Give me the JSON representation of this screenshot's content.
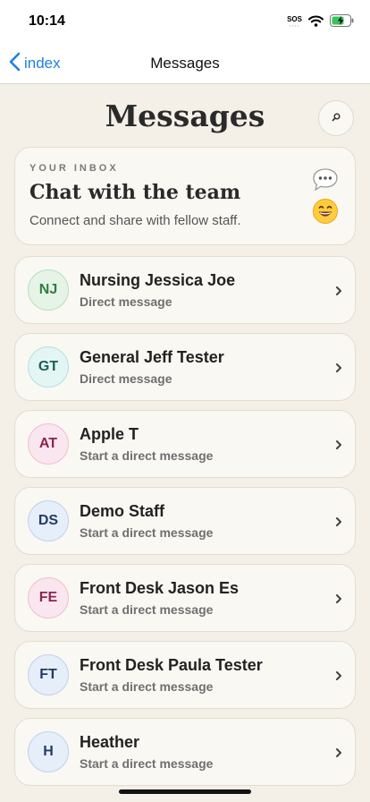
{
  "status_bar": {
    "time": "10:14",
    "sos": "SOS"
  },
  "nav": {
    "back_label": "index",
    "title": "Messages"
  },
  "page": {
    "title": "Messages"
  },
  "inbox_card": {
    "eyebrow": "YOUR INBOX",
    "heading": "Chat with the team",
    "subtitle": "Connect and share with fellow staff.",
    "icons": [
      "speech-bubble-icon",
      "grinning-face-icon"
    ]
  },
  "contacts": [
    {
      "initials": "NJ",
      "name": "Nursing Jessica Joe",
      "subtitle": "Direct message",
      "avatar_bg": "#e6f4e8",
      "avatar_border": "#b8dfc0",
      "avatar_fg": "#2e7d3e"
    },
    {
      "initials": "GT",
      "name": "General Jeff Tester",
      "subtitle": "Direct message",
      "avatar_bg": "#e3f6f4",
      "avatar_border": "#b3e3dc",
      "avatar_fg": "#1e5d58"
    },
    {
      "initials": "AT",
      "name": "Apple T",
      "subtitle": "Start a direct message",
      "avatar_bg": "#fae6ef",
      "avatar_border": "#efc0d4",
      "avatar_fg": "#8a2552"
    },
    {
      "initials": "DS",
      "name": "Demo Staff",
      "subtitle": "Start a direct message",
      "avatar_bg": "#e6eefa",
      "avatar_border": "#c1d3ee",
      "avatar_fg": "#233c66"
    },
    {
      "initials": "FE",
      "name": "Front Desk Jason Es",
      "subtitle": "Start a direct message",
      "avatar_bg": "#fae6ef",
      "avatar_border": "#efc0d4",
      "avatar_fg": "#8a2552"
    },
    {
      "initials": "FT",
      "name": "Front Desk Paula Tester",
      "subtitle": "Start a direct message",
      "avatar_bg": "#e6eefa",
      "avatar_border": "#c1d3ee",
      "avatar_fg": "#233c66"
    },
    {
      "initials": "H",
      "name": "Heather",
      "subtitle": "Start a direct message",
      "avatar_bg": "#e6eefa",
      "avatar_border": "#c1d3ee",
      "avatar_fg": "#233c66"
    }
  ],
  "colors": {
    "accent": "#1d7fe6",
    "background": "#f4f0e8",
    "card": "#faf8f3"
  }
}
